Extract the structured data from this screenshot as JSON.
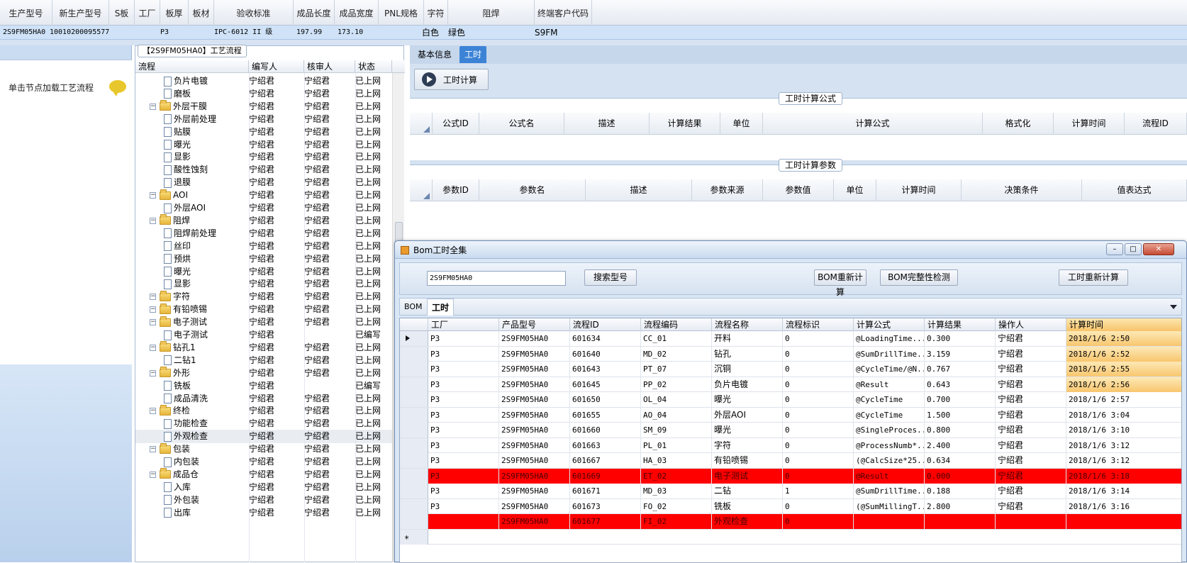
{
  "header": {
    "columns": [
      "生产型号",
      "新生产型号",
      "S板",
      "工厂",
      "板厚",
      "板材",
      "验收标准",
      "成品长度",
      "成品宽度",
      "PNL规格",
      "字符",
      "阻焊",
      "终端客户代码"
    ],
    "values": [
      "2S9FM05HA0",
      "10010200095577",
      "",
      "P3",
      "",
      "",
      "IPC-6012 II 级",
      "197.99",
      "173.10",
      "",
      "白色",
      "绿色",
      "S9FM"
    ]
  },
  "left": {
    "hint": "单击节点加载工艺流程",
    "bubble_icon": "speech-bubble-icon"
  },
  "tree": {
    "title": "【2S9FM05HA0】工艺流程",
    "columns": [
      "流程",
      "编写人",
      "核审人",
      "状态"
    ],
    "rows": [
      {
        "level": 1,
        "type": "doc",
        "name": "负片电镀",
        "writer": "宁绍君",
        "reviewer": "宁绍君",
        "status": "已上网"
      },
      {
        "level": 1,
        "type": "doc",
        "name": "磨板",
        "writer": "宁绍君",
        "reviewer": "宁绍君",
        "status": "已上网"
      },
      {
        "level": 0,
        "type": "folder",
        "name": "外层干膜",
        "writer": "宁绍君",
        "reviewer": "宁绍君",
        "status": "已上网"
      },
      {
        "level": 1,
        "type": "doc",
        "name": "外层前处理",
        "writer": "宁绍君",
        "reviewer": "宁绍君",
        "status": "已上网"
      },
      {
        "level": 1,
        "type": "doc",
        "name": "贴膜",
        "writer": "宁绍君",
        "reviewer": "宁绍君",
        "status": "已上网"
      },
      {
        "level": 1,
        "type": "doc",
        "name": "曝光",
        "writer": "宁绍君",
        "reviewer": "宁绍君",
        "status": "已上网"
      },
      {
        "level": 1,
        "type": "doc",
        "name": "显影",
        "writer": "宁绍君",
        "reviewer": "宁绍君",
        "status": "已上网"
      },
      {
        "level": 1,
        "type": "doc",
        "name": "酸性蚀刻",
        "writer": "宁绍君",
        "reviewer": "宁绍君",
        "status": "已上网"
      },
      {
        "level": 1,
        "type": "doc",
        "name": "退膜",
        "writer": "宁绍君",
        "reviewer": "宁绍君",
        "status": "已上网"
      },
      {
        "level": 0,
        "type": "folder",
        "name": "AOI",
        "writer": "宁绍君",
        "reviewer": "宁绍君",
        "status": "已上网"
      },
      {
        "level": 1,
        "type": "doc",
        "name": "外层AOI",
        "writer": "宁绍君",
        "reviewer": "宁绍君",
        "status": "已上网"
      },
      {
        "level": 0,
        "type": "folder",
        "name": "阻焊",
        "writer": "宁绍君",
        "reviewer": "宁绍君",
        "status": "已上网"
      },
      {
        "level": 1,
        "type": "doc",
        "name": "阻焊前处理",
        "writer": "宁绍君",
        "reviewer": "宁绍君",
        "status": "已上网"
      },
      {
        "level": 1,
        "type": "doc",
        "name": "丝印",
        "writer": "宁绍君",
        "reviewer": "宁绍君",
        "status": "已上网"
      },
      {
        "level": 1,
        "type": "doc",
        "name": "预烘",
        "writer": "宁绍君",
        "reviewer": "宁绍君",
        "status": "已上网"
      },
      {
        "level": 1,
        "type": "doc",
        "name": "曝光",
        "writer": "宁绍君",
        "reviewer": "宁绍君",
        "status": "已上网"
      },
      {
        "level": 1,
        "type": "doc",
        "name": "显影",
        "writer": "宁绍君",
        "reviewer": "宁绍君",
        "status": "已上网"
      },
      {
        "level": 0,
        "type": "folder",
        "name": "字符",
        "writer": "宁绍君",
        "reviewer": "宁绍君",
        "status": "已上网"
      },
      {
        "level": 0,
        "type": "folder",
        "name": "有铅喷锡",
        "writer": "宁绍君",
        "reviewer": "宁绍君",
        "status": "已上网"
      },
      {
        "level": 0,
        "type": "folder",
        "name": "电子测试",
        "writer": "宁绍君",
        "reviewer": "宁绍君",
        "status": "已上网"
      },
      {
        "level": 1,
        "type": "doc",
        "name": "电子测试",
        "writer": "宁绍君",
        "reviewer": "",
        "status": "已编写"
      },
      {
        "level": 0,
        "type": "folder",
        "name": "钻孔1",
        "writer": "宁绍君",
        "reviewer": "宁绍君",
        "status": "已上网"
      },
      {
        "level": 1,
        "type": "doc",
        "name": "二钻1",
        "writer": "宁绍君",
        "reviewer": "宁绍君",
        "status": "已上网"
      },
      {
        "level": 0,
        "type": "folder",
        "name": "外形",
        "writer": "宁绍君",
        "reviewer": "宁绍君",
        "status": "已上网"
      },
      {
        "level": 1,
        "type": "doc",
        "name": "铣板",
        "writer": "宁绍君",
        "reviewer": "",
        "status": "已编写"
      },
      {
        "level": 1,
        "type": "doc",
        "name": "成品清洗",
        "writer": "宁绍君",
        "reviewer": "宁绍君",
        "status": "已上网"
      },
      {
        "level": 0,
        "type": "folder",
        "name": "终检",
        "writer": "宁绍君",
        "reviewer": "宁绍君",
        "status": "已上网"
      },
      {
        "level": 1,
        "type": "doc",
        "name": "功能检查",
        "writer": "宁绍君",
        "reviewer": "宁绍君",
        "status": "已上网"
      },
      {
        "level": 1,
        "type": "doc",
        "name": "外观检查",
        "writer": "宁绍君",
        "reviewer": "宁绍君",
        "status": "已上网"
      },
      {
        "level": 0,
        "type": "folder",
        "name": "包装",
        "writer": "宁绍君",
        "reviewer": "宁绍君",
        "status": "已上网"
      },
      {
        "level": 1,
        "type": "doc",
        "name": "内包装",
        "writer": "宁绍君",
        "reviewer": "宁绍君",
        "status": "已上网"
      },
      {
        "level": 0,
        "type": "folder",
        "name": "成品仓",
        "writer": "宁绍君",
        "reviewer": "宁绍君",
        "status": "已上网"
      },
      {
        "level": 1,
        "type": "doc",
        "name": "入库",
        "writer": "宁绍君",
        "reviewer": "宁绍君",
        "status": "已上网"
      },
      {
        "level": 1,
        "type": "doc",
        "name": "外包装",
        "writer": "宁绍君",
        "reviewer": "宁绍君",
        "status": "已上网"
      },
      {
        "level": 1,
        "type": "doc",
        "name": "出库",
        "writer": "宁绍君",
        "reviewer": "宁绍君",
        "status": "已上网"
      }
    ]
  },
  "right": {
    "tabs": [
      "基本信息",
      "工时"
    ],
    "calc_button": "工时计算",
    "formula_group": {
      "title": "工时计算公式",
      "columns": [
        "公式ID",
        "公式名",
        "描述",
        "计算结果",
        "单位",
        "计算公式",
        "格式化",
        "计算时间",
        "流程ID"
      ]
    },
    "param_group": {
      "title": "工时计算参数",
      "columns": [
        "参数ID",
        "参数名",
        "描述",
        "参数来源",
        "参数值",
        "单位",
        "计算时间",
        "决策条件",
        "值表达式"
      ]
    }
  },
  "dialog": {
    "title": "Bom工时全集",
    "search_value": "2S9FM05HA0",
    "buttons": {
      "search": "搜索型号",
      "bom_recalc": "BOM重新计算",
      "bom_check": "BOM完整性检测",
      "time_recalc": "工时重新计算"
    },
    "tabs": [
      "BOM",
      "工时"
    ],
    "columns": [
      "工厂",
      "产品型号",
      "流程ID",
      "流程编码",
      "流程名称",
      "流程标识",
      "计算公式",
      "计算结果",
      "操作人",
      "计算时间"
    ],
    "rows": [
      {
        "red": false,
        "cells": [
          "P3",
          "2S9FM05HA0",
          "601634",
          "CC_01",
          "开料",
          "0",
          "@LoadingTime...",
          "0.300",
          "宁绍君",
          "2018/1/6 2:50"
        ],
        "hl": true
      },
      {
        "red": false,
        "cells": [
          "P3",
          "2S9FM05HA0",
          "601640",
          "MD_02",
          "钻孔",
          "0",
          "@SumDrillTime...",
          "3.159",
          "宁绍君",
          "2018/1/6 2:52"
        ],
        "hl": true
      },
      {
        "red": false,
        "cells": [
          "P3",
          "2S9FM05HA0",
          "601643",
          "PT_07",
          "沉铜",
          "0",
          "@CycleTime/@N...",
          "0.767",
          "宁绍君",
          "2018/1/6 2:55"
        ],
        "hl": true
      },
      {
        "red": false,
        "cells": [
          "P3",
          "2S9FM05HA0",
          "601645",
          "PP_02",
          "负片电镀",
          "0",
          "@Result",
          "0.643",
          "宁绍君",
          "2018/1/6 2:56"
        ],
        "hl": true
      },
      {
        "red": false,
        "cells": [
          "P3",
          "2S9FM05HA0",
          "601650",
          "OL_04",
          "曝光",
          "0",
          "@CycleTime",
          "0.700",
          "宁绍君",
          "2018/1/6 2:57"
        ],
        "hl": false
      },
      {
        "red": false,
        "cells": [
          "P3",
          "2S9FM05HA0",
          "601655",
          "AO_04",
          "外层AOI",
          "0",
          "@CycleTime",
          "1.500",
          "宁绍君",
          "2018/1/6 3:04"
        ],
        "hl": false
      },
      {
        "red": false,
        "cells": [
          "P3",
          "2S9FM05HA0",
          "601660",
          "SM_09",
          "曝光",
          "0",
          "@SingleProces...",
          "0.800",
          "宁绍君",
          "2018/1/6 3:10"
        ],
        "hl": false
      },
      {
        "red": false,
        "cells": [
          "P3",
          "2S9FM05HA0",
          "601663",
          "PL_01",
          "字符",
          "0",
          "@ProcessNumb*...",
          "2.400",
          "宁绍君",
          "2018/1/6 3:12"
        ],
        "hl": false
      },
      {
        "red": false,
        "cells": [
          "P3",
          "2S9FM05HA0",
          "601667",
          "HA_03",
          "有铅喷锡",
          "0",
          "(@CalcSize*25...",
          "0.634",
          "宁绍君",
          "2018/1/6 3:12"
        ],
        "hl": false
      },
      {
        "red": true,
        "cells": [
          "P3",
          "2S9FM05HA0",
          "601669",
          "ET_02",
          "电子测试",
          "0",
          "@Result",
          "0.000",
          "宁绍君",
          "2018/1/6 3:18"
        ],
        "hl": false
      },
      {
        "red": false,
        "cells": [
          "P3",
          "2S9FM05HA0",
          "601671",
          "MD_03",
          "二钻",
          "1",
          "@SumDrillTime...",
          "0.188",
          "宁绍君",
          "2018/1/6 3:14"
        ],
        "hl": false
      },
      {
        "red": false,
        "cells": [
          "P3",
          "2S9FM05HA0",
          "601673",
          "FO_02",
          "铣板",
          "0",
          "(@SumMillingT...",
          "2.800",
          "宁绍君",
          "2018/1/6 3:16"
        ],
        "hl": false
      },
      {
        "red": true,
        "cells": [
          "",
          "2S9FM05HA0",
          "601677",
          "FI_02",
          "外观检查",
          "0",
          "",
          "",
          "",
          ""
        ],
        "hl": false
      }
    ],
    "new_row_marker": "*"
  }
}
